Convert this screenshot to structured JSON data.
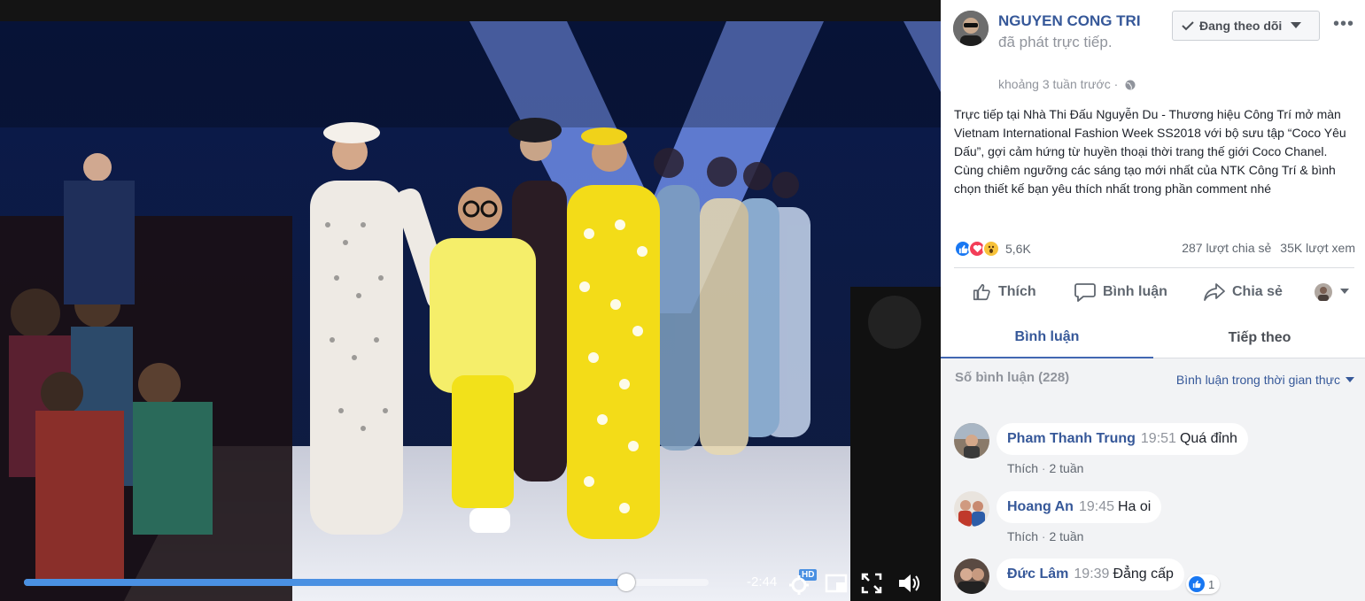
{
  "video": {
    "time_remaining": "-2:44",
    "progress": 0.88,
    "hd_label": "HD"
  },
  "post": {
    "author": "NGUYEN CONG TRI",
    "action": " đã phát trực tiếp.",
    "time": "khoảng 3 tuần trước",
    "follow_label": "Đang theo dõi",
    "text": "Trực tiếp tại Nhà Thi Đấu Nguyễn Du - Thương hiệu Công Trí mở màn Vietnam International Fashion Week SS2018 với bộ sưu tập “Coco Yêu Dấu”, gợi cảm hứng từ huyền thoại thời trang thế giới Coco Chanel. Cùng chiêm ngưỡng các sáng tạo mới nhất của NTK Công Trí & bình chọn thiết kế bạn yêu thích nhất trong phần comment nhé",
    "reactions_count": "5,6K",
    "shares": "287 lượt chia sẻ",
    "views": "35K lượt xem"
  },
  "actions": {
    "like": "Thích",
    "comment": "Bình luận",
    "share": "Chia sẻ"
  },
  "tabs": [
    {
      "label": "Bình luận"
    },
    {
      "label": "Tiếp theo"
    }
  ],
  "comments_header": {
    "count_label": "Số bình luận (228)",
    "filter_label": "Bình luận trong thời gian thực"
  },
  "comments": [
    {
      "name": "Pham Thanh Trung",
      "time": "19:51",
      "text": "Quá đỉnh",
      "like_label": "Thích",
      "age": "2 tuần"
    },
    {
      "name": "Hoang An",
      "time": "19:45",
      "text": "Ha oi",
      "like_label": "Thích",
      "age": "2 tuần"
    },
    {
      "name": "Đức Lâm",
      "time": "19:39",
      "text": "Đẳng cấp",
      "likes": "1"
    }
  ],
  "colors": {
    "link": "#365899",
    "accent": "#4267b2",
    "progress": "#4a90e2"
  }
}
